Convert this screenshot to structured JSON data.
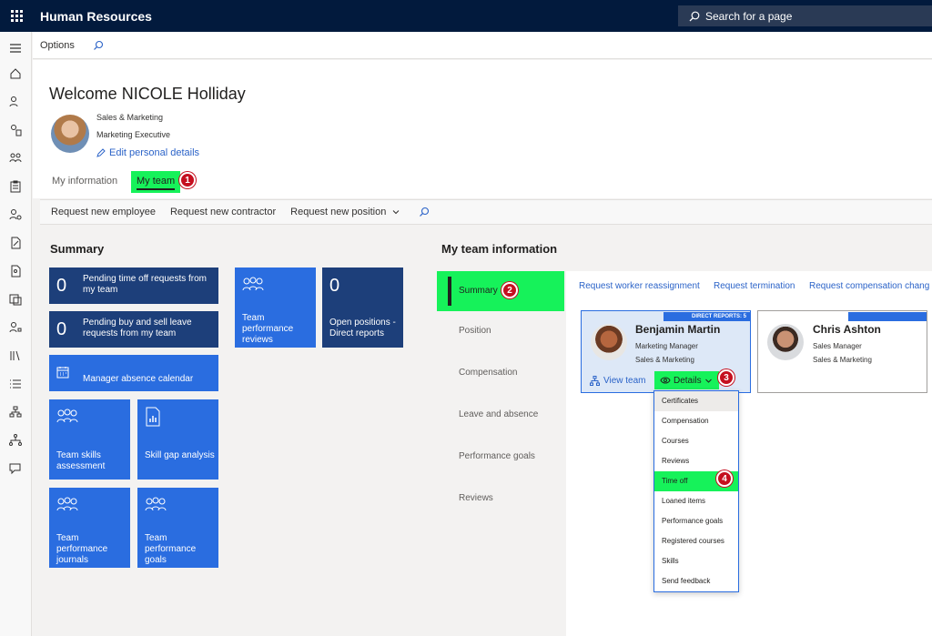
{
  "app": {
    "title": "Human Resources",
    "search_placeholder": "Search for a page"
  },
  "options_bar": {
    "options_label": "Options"
  },
  "header": {
    "welcome": "Welcome NICOLE Holliday",
    "department": "Sales & Marketing",
    "job_title": "Marketing Executive",
    "edit_link": "Edit personal details",
    "tabs": [
      {
        "label": "My information"
      },
      {
        "label": "My team"
      }
    ]
  },
  "action_bar": {
    "items": [
      {
        "label": "Request new employee"
      },
      {
        "label": "Request new contractor"
      },
      {
        "label": "Request new position"
      }
    ]
  },
  "summary": {
    "title": "Summary",
    "tiles": [
      {
        "count": "0",
        "label": "Pending time off requests from my team"
      },
      {
        "count": "0",
        "label": "Pending buy and sell leave requests from my team"
      },
      {
        "label": "Manager absence calendar"
      },
      {
        "label": "Team skills assessment"
      },
      {
        "label": "Skill gap analysis"
      },
      {
        "label": "Team performance journals"
      },
      {
        "label": "Team performance goals"
      },
      {
        "label": "Team performance reviews"
      },
      {
        "count": "0",
        "label": "Open positions - Direct reports"
      }
    ]
  },
  "team_info": {
    "title": "My team information",
    "tabs": [
      {
        "label": "Summary"
      },
      {
        "label": "Position"
      },
      {
        "label": "Compensation"
      },
      {
        "label": "Leave and absence"
      },
      {
        "label": "Performance goals"
      },
      {
        "label": "Reviews"
      }
    ],
    "links": [
      {
        "label": "Request worker reassignment"
      },
      {
        "label": "Request termination"
      },
      {
        "label": "Request compensation chang"
      }
    ],
    "cards": [
      {
        "direct_reports": "DIRECT REPORTS: 5",
        "name": "Benjamin Martin",
        "title": "Marketing Manager",
        "department": "Sales & Marketing",
        "view_team": "View team",
        "details": "Details"
      },
      {
        "name": "Chris Ashton",
        "title": "Sales Manager",
        "department": "Sales & Marketing"
      }
    ],
    "details_menu": [
      "Certificates",
      "Compensation",
      "Courses",
      "Reviews",
      "Time off",
      "Loaned items",
      "Performance goals",
      "Registered courses",
      "Skills",
      "Send feedback"
    ]
  },
  "callouts": [
    "1",
    "2",
    "3",
    "4"
  ],
  "colors": {
    "topbar": "#021a3d",
    "tile_dark": "#1d3f7a",
    "tile_blue": "#2a6de0",
    "highlight_green": "#16f25a",
    "callout_red": "#c50f1f",
    "link_blue": "#2b63c8"
  }
}
